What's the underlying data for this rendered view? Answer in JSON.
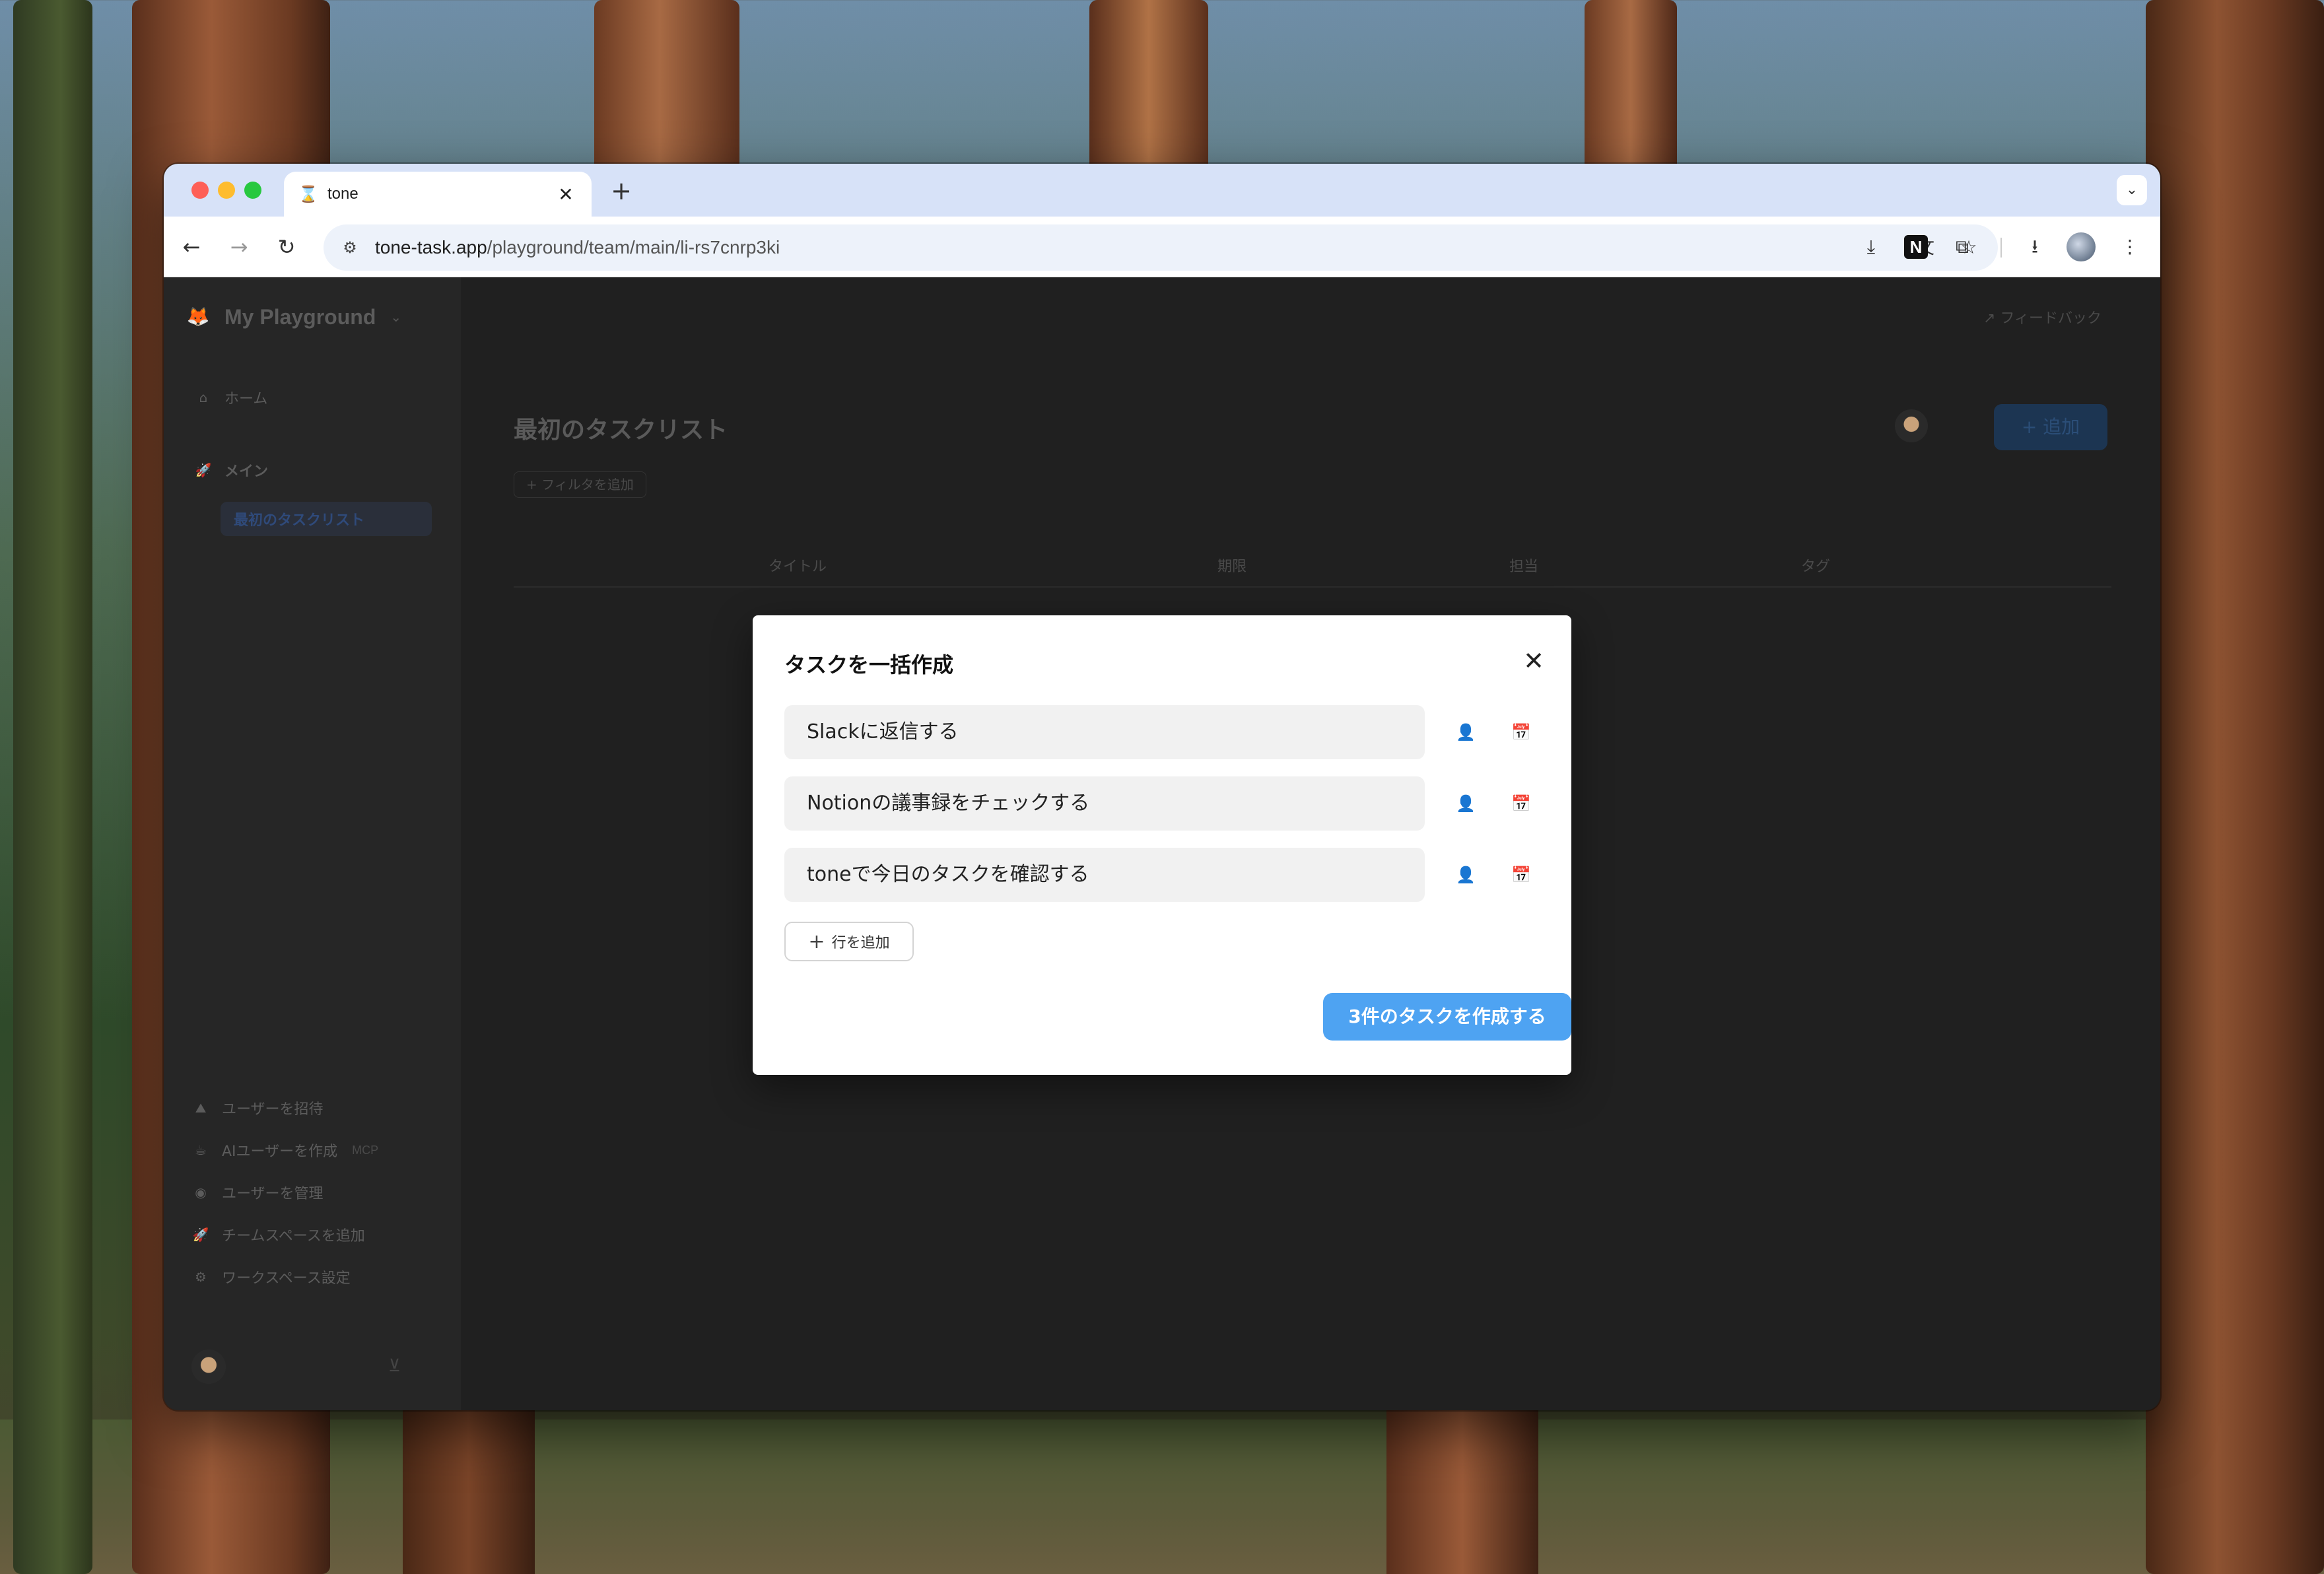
{
  "browser": {
    "tab_title": "tone",
    "tab_close": "✕",
    "new_tab": "+",
    "url_host": "tone-task.app",
    "url_path": "/playground/team/main/li-rs7cnrp3ki"
  },
  "sidebar": {
    "workspace_name": "My Playground",
    "home": "ホーム",
    "main_section": "メイン",
    "first_list": "最初のタスクリスト",
    "invite_user": "ユーザーを招待",
    "create_ai_user": "AIユーザーを作成",
    "mcp_tag": "MCP",
    "manage_users": "ユーザーを管理",
    "add_teamspace": "チームスペースを追加",
    "workspace_settings": "ワークスペース設定"
  },
  "main": {
    "feedback": "フィードバック",
    "list_title": "最初のタスクリスト",
    "add_button": "+ 追加",
    "add_filter": "+ フィルタを追加",
    "columns": [
      "タイトル",
      "期限",
      "担当",
      "タグ"
    ]
  },
  "modal": {
    "title": "タスクを一括作成",
    "tasks": [
      "Slackに返信する",
      "Notionの議事録をチェックする",
      "toneで今日のタスクを確認する"
    ],
    "add_row": "行を追加",
    "create_button": "3件のタスクを作成する"
  },
  "icons": {
    "assignee": "user-plus-icon",
    "due_date": "calendar-plus-icon"
  },
  "colors": {
    "primary": "#4ea3f2",
    "tab_bar": "#d7e2f8"
  }
}
